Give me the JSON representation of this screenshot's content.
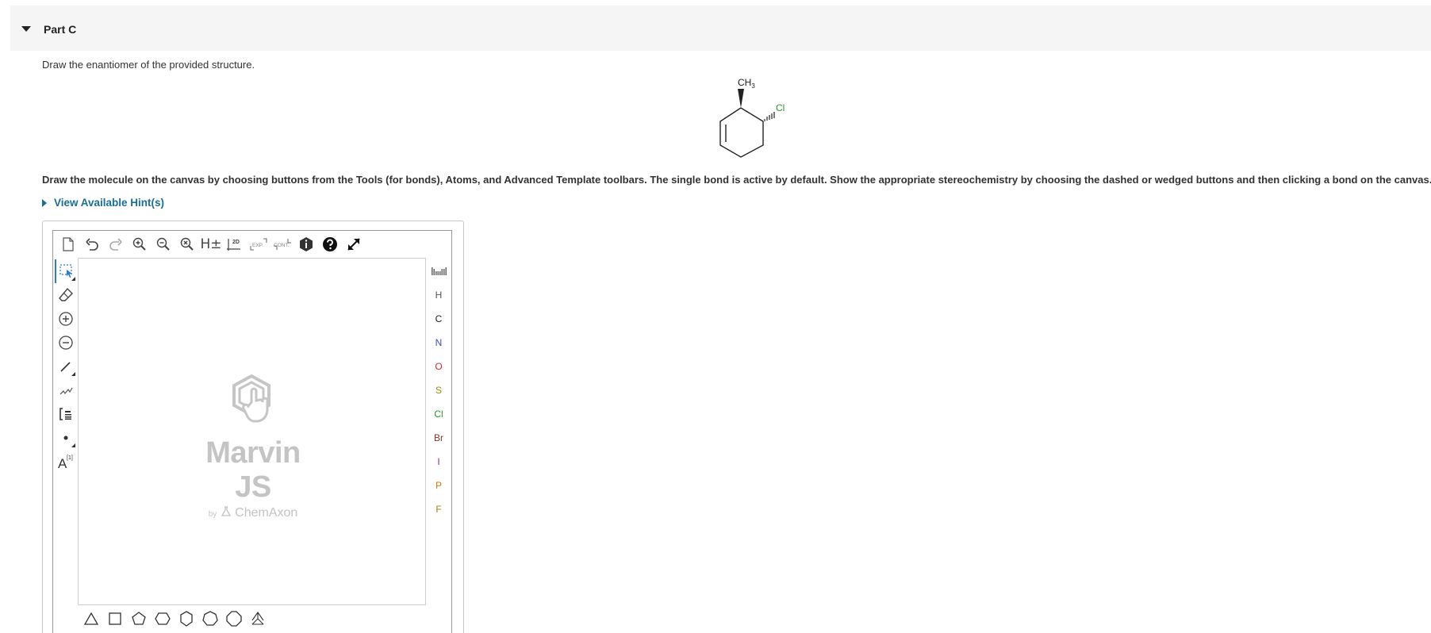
{
  "part": {
    "title": "Part C"
  },
  "question": {
    "instruction": "Draw the enantiomer of the provided structure.",
    "molecule_labels": {
      "methyl_c": "CH",
      "methyl_sub": "3",
      "chloro": "Cl"
    },
    "directions": "Draw the molecule on the canvas by choosing buttons from the Tools (for bonds), Atoms, and Advanced Template toolbars. The single bond is active by default. Show the appropriate stereochemistry by choosing the dashed or wedged buttons and then clicking a bond on the canvas.",
    "hint_label": "View Available Hint(s)"
  },
  "editor": {
    "top_toolbar": {
      "clean_h_label": "H±",
      "clean2d_label": "2D",
      "expand_label": "EXP.",
      "contract_label": "CONT."
    },
    "atom_label_tool": {
      "text": "A",
      "superscript": "[1]"
    },
    "watermark": {
      "product": "Marvin JS",
      "by": "by",
      "company": "ChemAxon"
    },
    "atoms": [
      {
        "symbol": "H",
        "color": "#555555"
      },
      {
        "symbol": "C",
        "color": "#222222"
      },
      {
        "symbol": "N",
        "color": "#3b4cc0"
      },
      {
        "symbol": "O",
        "color": "#d43030"
      },
      {
        "symbol": "S",
        "color": "#9a8a10"
      },
      {
        "symbol": "Cl",
        "color": "#2a9a2a"
      },
      {
        "symbol": "Br",
        "color": "#7a3a2a"
      },
      {
        "symbol": "I",
        "color": "#8a2a9a"
      },
      {
        "symbol": "P",
        "color": "#d07a10"
      },
      {
        "symbol": "F",
        "color": "#9a8a10"
      }
    ]
  },
  "colors": {
    "accent": "#1a6e9a",
    "chloro": "#2a9a2a",
    "selection": "#2e7bd6"
  }
}
